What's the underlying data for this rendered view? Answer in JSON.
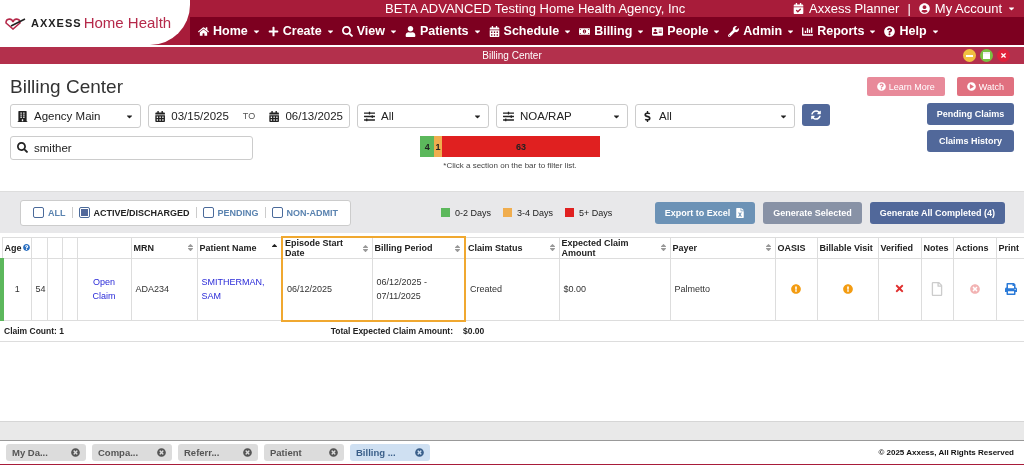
{
  "header": {
    "logo_brand": "AXXESS",
    "logo_product": "Home Health",
    "agency": "BETA ADVANCED Testing Home Health Agency, Inc",
    "links": [
      "Axxess Planner",
      "My Account"
    ],
    "separator": "|",
    "nav": [
      "Home",
      "Create",
      "View",
      "Patients",
      "Schedule",
      "Billing",
      "People",
      "Admin",
      "Reports",
      "Help"
    ]
  },
  "window": {
    "title": "Billing Center"
  },
  "page": {
    "title": "Billing Center",
    "buttons": [
      "Learn More",
      "Watch"
    ],
    "side_buttons": [
      "Pending Claims",
      "Claims History"
    ]
  },
  "filters": {
    "branch": "Agency Main",
    "date_from": "03/15/2025",
    "date_sep": "TO",
    "date_to": "06/13/2025",
    "filter_1": "All",
    "filter_2": "NOA/RAP",
    "payer": "All",
    "search": "smither"
  },
  "age_bar": {
    "segments": [
      {
        "label": "4",
        "color": "#5cb85c"
      },
      {
        "label": "1",
        "color": "#f0ad4e"
      },
      {
        "label": "63",
        "color": "#e02020"
      }
    ],
    "note": "*Click a section on the bar to filter list."
  },
  "status_filters": [
    {
      "label": "ALL",
      "checked": false,
      "selected": false
    },
    {
      "label": "ACTIVE/DISCHARGED",
      "checked": true,
      "selected": true
    },
    {
      "label": "PENDING",
      "checked": false,
      "selected": false
    },
    {
      "label": "NON-ADMIT",
      "checked": false,
      "selected": false
    }
  ],
  "legend": [
    {
      "label": "0-2 Days",
      "color": "#5cb85c"
    },
    {
      "label": "3-4 Days",
      "color": "#f0ad4e"
    },
    {
      "label": "5+ Days",
      "color": "#e02020"
    }
  ],
  "actions": [
    {
      "label": "Export to Excel",
      "disabled": false,
      "kind": "export"
    },
    {
      "label": "Generate Selected",
      "disabled": true,
      "kind": "plain"
    },
    {
      "label": "Generate All Completed (4)",
      "disabled": false,
      "kind": "primary"
    }
  ],
  "table": {
    "columns": [
      {
        "label": "Age",
        "sortable": false,
        "sorted": false,
        "highlighted": false,
        "help": true
      },
      {
        "sortable": false,
        "sorted": false,
        "highlighted": false,
        "help": false
      },
      {
        "sortable": false,
        "sorted": false,
        "highlighted": false,
        "help": false
      },
      {
        "sortable": false,
        "sorted": false,
        "highlighted": false,
        "help": false
      },
      {
        "sortable": false,
        "sorted": false,
        "highlighted": false,
        "help": false
      },
      {
        "label": "MRN",
        "sortable": true,
        "sorted": false,
        "highlighted": false,
        "help": false
      },
      {
        "label": "Patient Name",
        "sortable": true,
        "sorted": true,
        "highlighted": false,
        "help": false
      },
      {
        "label": "Episode Start Date",
        "sortable": true,
        "sorted": false,
        "highlighted": true,
        "help": false
      },
      {
        "label": "Billing Period",
        "sortable": true,
        "sorted": false,
        "highlighted": true,
        "help": false
      },
      {
        "label": "Claim Status",
        "sortable": true,
        "sorted": false,
        "highlighted": false,
        "help": false
      },
      {
        "label": "Expected Claim Amount",
        "sortable": true,
        "sorted": false,
        "highlighted": false,
        "help": false
      },
      {
        "label": "Payer",
        "sortable": true,
        "sorted": false,
        "highlighted": false,
        "help": false
      },
      {
        "label": "OASIS",
        "sortable": false,
        "sorted": false,
        "highlighted": false,
        "help": false
      },
      {
        "label": "Billable Visit",
        "sortable": false,
        "sorted": false,
        "highlighted": false,
        "help": false
      },
      {
        "label": "Verified",
        "sortable": false,
        "sorted": false,
        "highlighted": false,
        "help": false
      },
      {
        "label": "Notes",
        "sortable": false,
        "sorted": false,
        "highlighted": false,
        "help": false
      },
      {
        "label": "Actions",
        "sortable": false,
        "sorted": false,
        "highlighted": false,
        "help": false
      },
      {
        "label": "Print",
        "sortable": false,
        "sorted": false,
        "highlighted": false,
        "help": false
      }
    ],
    "rows": [
      {
        "color": "#5cb85c",
        "cells": [
          {
            "kind": "text",
            "text": "1"
          },
          {
            "kind": "text",
            "text": "54"
          },
          {
            "kind": "empty"
          },
          {
            "kind": "empty"
          },
          {
            "kind": "link",
            "text": "Open Claim"
          },
          {
            "kind": "text",
            "text": "ADA234"
          },
          {
            "kind": "link",
            "text": "SMITHERMAN, SAM"
          },
          {
            "kind": "text",
            "text": "06/12/2025"
          },
          {
            "kind": "text",
            "text": "06/12/2025 - 07/11/2025"
          },
          {
            "kind": "text",
            "text": "Created"
          },
          {
            "kind": "text",
            "text": "$0.00"
          },
          {
            "kind": "text",
            "text": "Palmetto"
          },
          {
            "kind": "warning"
          },
          {
            "kind": "warning"
          },
          {
            "kind": "cross"
          },
          {
            "kind": "notes"
          },
          {
            "kind": "action"
          },
          {
            "kind": "print"
          }
        ]
      }
    ],
    "footer": {
      "count": "Claim Count: 1",
      "total_label": "Total Expected Claim Amount:",
      "total": "$0.00"
    }
  },
  "taskbar": {
    "tabs": [
      {
        "label": "My Da...",
        "selected": false
      },
      {
        "label": "Compa...",
        "selected": false
      },
      {
        "label": "Referr...",
        "selected": false
      },
      {
        "label": "Patient",
        "selected": false
      },
      {
        "label": "Billing ...",
        "selected": true
      }
    ],
    "copyright": "© 2025 Axxess, All Rights Reserved"
  }
}
